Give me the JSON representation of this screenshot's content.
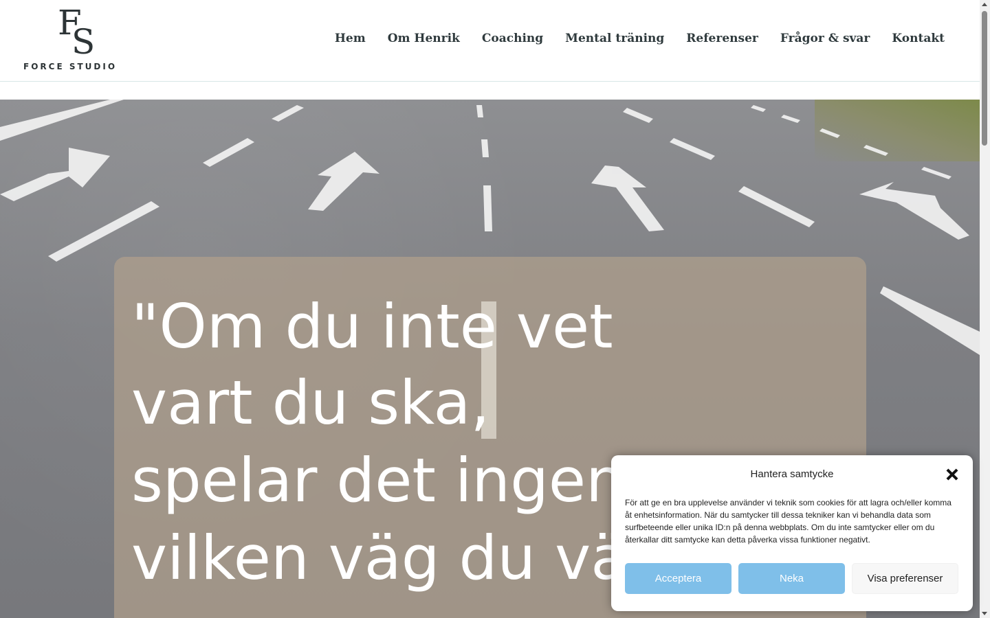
{
  "header": {
    "logo_mark_f": "F",
    "logo_mark_s": "S",
    "logo_text": "FORCE STUDIO"
  },
  "nav": {
    "items": [
      {
        "label": "Hem"
      },
      {
        "label": "Om Henrik"
      },
      {
        "label": "Coaching"
      },
      {
        "label": "Mental träning"
      },
      {
        "label": "Referenser"
      },
      {
        "label": "Frågor & svar"
      },
      {
        "label": "Kontakt"
      }
    ]
  },
  "hero": {
    "quote_lines": [
      "\"Om du inte vet",
      "vart du ska,",
      "spelar det ingen",
      "vilken väg du väl"
    ]
  },
  "consent": {
    "title": "Hantera samtycke",
    "text": "För att ge en bra upplevelse använder vi teknik som cookies för att lagra och/eller komma åt enhetsinformation. När du samtycker till dessa tekniker kan vi behandla data som surfbeteende eller unika ID:n på denna webbplats. Om du inte samtycker eller om du återkallar ditt samtycke kan detta påverka vissa funktioner negativt.",
    "accept_label": "Acceptera",
    "deny_label": "Neka",
    "prefs_label": "Visa preferenser",
    "button_color": "#7fbfe9"
  },
  "icons": {
    "close": "close-icon",
    "scroll_up": "scroll-up-arrow-icon",
    "scroll_down": "scroll-down-arrow-icon"
  }
}
